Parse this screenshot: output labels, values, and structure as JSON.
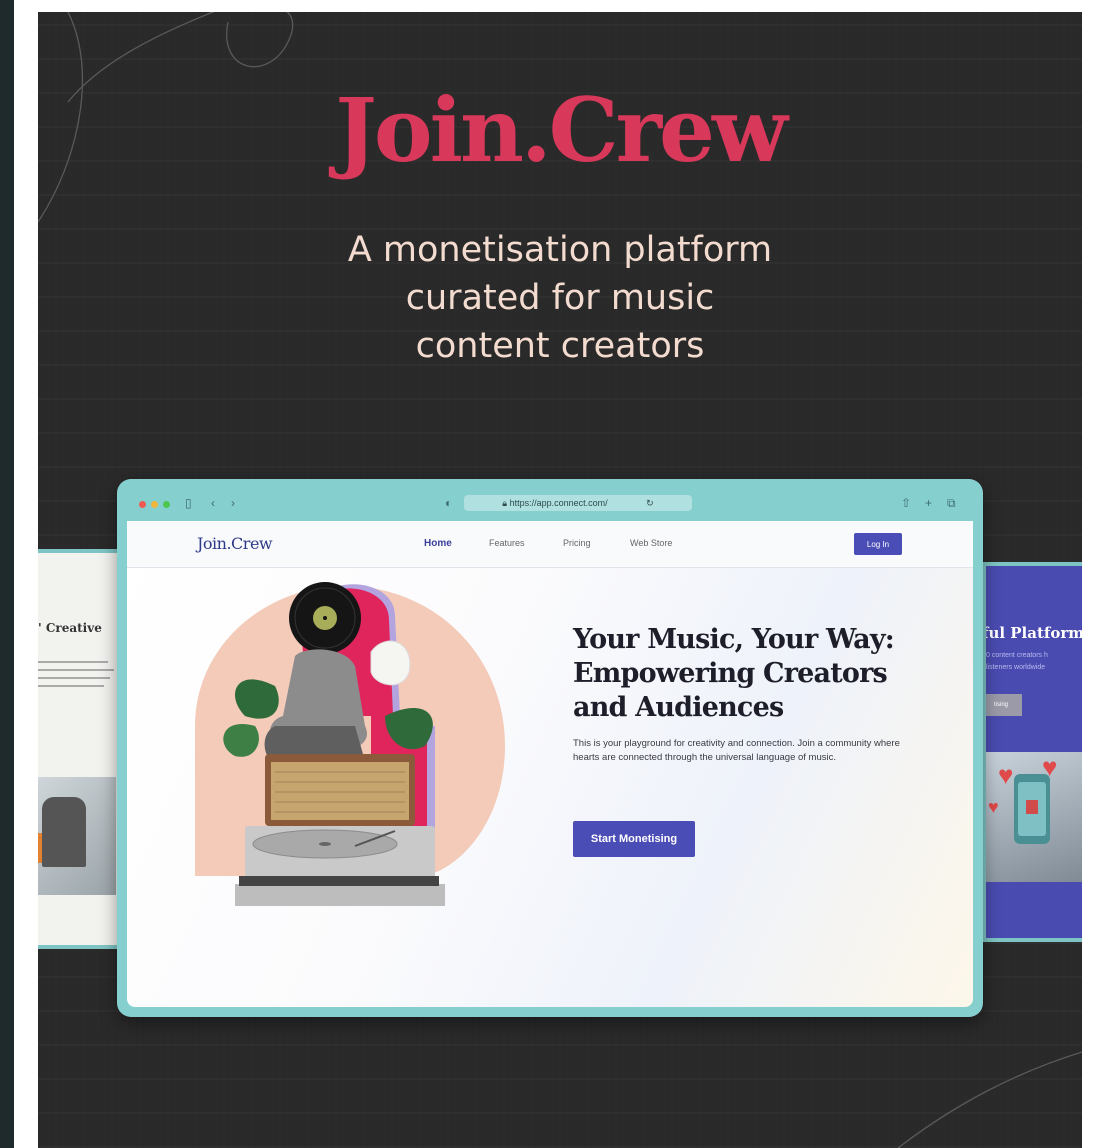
{
  "hero_banner": {
    "brand": "Join.Crew",
    "tagline_lines": [
      "A monetisation platform",
      "curated for music",
      "content creators"
    ]
  },
  "browser": {
    "url": "https://app.connect.com/",
    "toolbar_icons": [
      "close-dot",
      "minimize-dot",
      "maximize-dot",
      "sidebar-icon",
      "back-icon",
      "forward-icon",
      "privacy-shield-icon",
      "reload-icon",
      "share-icon",
      "new-tab-icon",
      "tabs-overview-icon"
    ]
  },
  "site": {
    "logo": "Join.Crew",
    "nav": [
      {
        "label": "Home",
        "active": true
      },
      {
        "label": "Features",
        "active": false
      },
      {
        "label": "Pricing",
        "active": false
      },
      {
        "label": "Web Store",
        "active": false
      }
    ],
    "login_label": "Log In",
    "hero_title": "Your Music, Your Way: Empowering Creators and Audiences",
    "hero_description": "This is your playground for creativity and connection. Join a community where hearts are connected through the universal language of music.",
    "cta_label": "Start Monetising"
  },
  "ghost_left": {
    "title": "' Creative"
  },
  "ghost_right": {
    "title": "ful Platform,",
    "line1": "0 content creators h",
    "line2": "listeners worldwide",
    "button": "tising"
  },
  "colors": {
    "background": "#2a2a2a",
    "brand_red": "#d8385a",
    "tagline": "#f3dccf",
    "browser_frame": "#86cfcf",
    "accent_blue": "#4b4db6"
  }
}
